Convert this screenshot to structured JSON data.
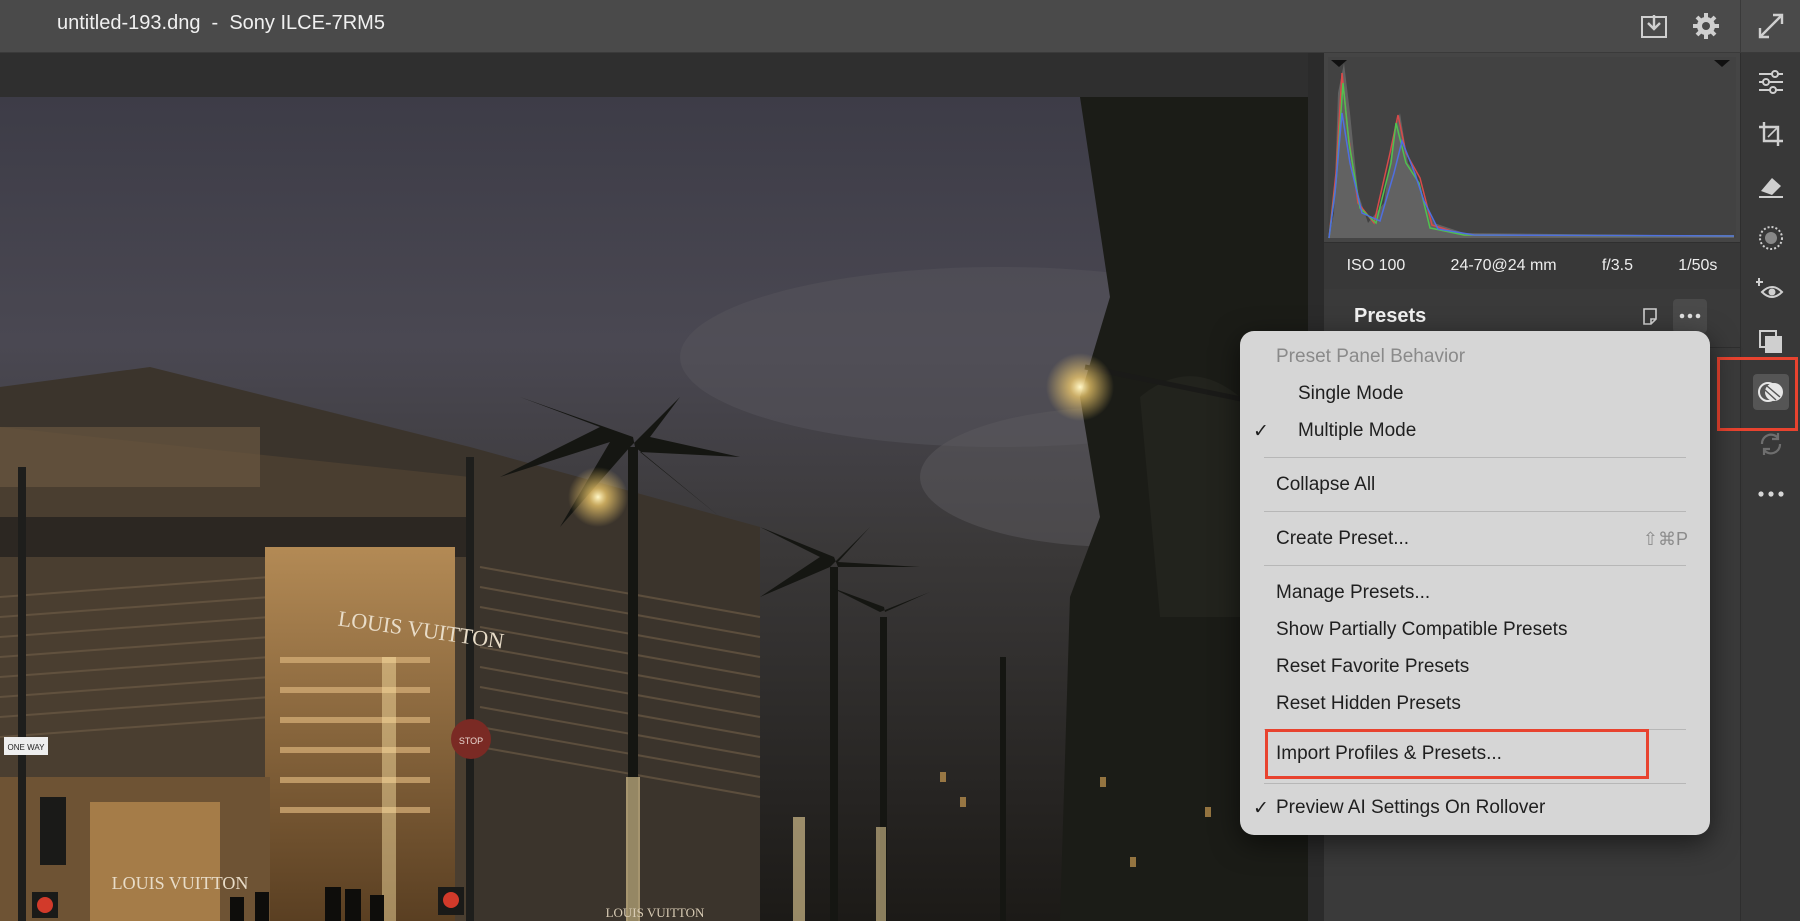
{
  "title_bar": {
    "document_title": "untitled-193.dng  -  Sony ILCE-7RM5",
    "icons": [
      "save-download-icon",
      "settings-gear-icon",
      "fullscreen-expand-icon"
    ]
  },
  "histogram": {
    "exif": {
      "iso": "ISO 100",
      "lens": "24-70@24 mm",
      "aperture": "f/3.5",
      "shutter": "1/50s"
    }
  },
  "presets_panel": {
    "title": "Presets",
    "icons": [
      "new-preset-icon",
      "more-options-icon"
    ]
  },
  "tool_strip": {
    "tools": [
      "edit-sliders-icon",
      "crop-icon",
      "remove-eraser-icon",
      "masking-icon",
      "red-eye-icon",
      "snapshots-icon",
      "presets-icon",
      "sync-icon",
      "more-icon"
    ],
    "active_tool": "presets-icon"
  },
  "menu": {
    "section_header": "Preset Panel Behavior",
    "single_mode": "Single Mode",
    "multiple_mode": "Multiple Mode",
    "multiple_mode_check": "✓",
    "collapse_all": "Collapse All",
    "create_preset": "Create Preset...",
    "create_preset_shortcut": "⇧⌘P",
    "manage_presets": "Manage Presets...",
    "show_partially_compatible": "Show Partially Compatible Presets",
    "reset_favorite": "Reset Favorite Presets",
    "reset_hidden": "Reset Hidden Presets",
    "import_profiles": "Import Profiles & Presets...",
    "preview_ai": "Preview AI Settings On Rollover",
    "preview_ai_check": "✓"
  },
  "photo": {
    "signs": [
      "LOUIS VUITTON",
      "LOUIS VUITTON",
      "LOUIS VUITTON",
      "ONE WAY",
      "STOP"
    ]
  },
  "colors": {
    "highlight_red": "#e8432f",
    "menu_bg": "#d6d6d6"
  }
}
